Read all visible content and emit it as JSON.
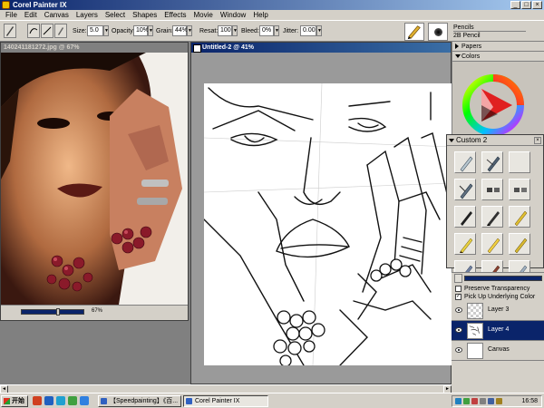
{
  "window": {
    "title": "Corel Painter IX",
    "minimize": "_",
    "maximize": "□",
    "close": "×"
  },
  "menu": [
    "File",
    "Edit",
    "Canvas",
    "Layers",
    "Select",
    "Shapes",
    "Effects",
    "Movie",
    "Window",
    "Help"
  ],
  "toolbar": {
    "size_label": "Size:",
    "size_value": "5.0",
    "opacity_label": "Opacity:",
    "opacity_value": "10%",
    "grain_label": "Grain:",
    "grain_value": "44%",
    "resat_label": "Resat:",
    "resat_value": "100",
    "bleed_label": "Bleed:",
    "bleed_value": "0%",
    "jitter_label": "Jitter:",
    "jitter_value": "0.00",
    "brush_category": "Pencils",
    "brush_variant": "2B Pencil"
  },
  "photo_window": {
    "title": "140241181272.jpg @ 67%",
    "zoom_label": "67%",
    "zoom_fraction": 0.6
  },
  "canvas_window": {
    "title": "Untitled-2 @ 41%"
  },
  "palettes": {
    "papers": "Papers",
    "colors": "Colors",
    "custom_title": "Custom 2",
    "custom_close": "×"
  },
  "layers": {
    "preserve_transparency": "Preserve Transparency",
    "pick_up_color": "Pick Up Underlying Color",
    "pick_up_checked": "✓",
    "items": [
      {
        "name": "Layer 3",
        "selected": false
      },
      {
        "name": "Layer 4",
        "selected": true
      },
      {
        "name": "Canvas",
        "selected": false
      }
    ]
  },
  "taskbar": {
    "start": "开始",
    "tasks": [
      "【Speedpainting】《百...",
      "Corel Painter IX"
    ],
    "clock": "16:58"
  },
  "colors_accent": {
    "titlebar": "#0a246a",
    "selected_layer": "#0a246a"
  }
}
